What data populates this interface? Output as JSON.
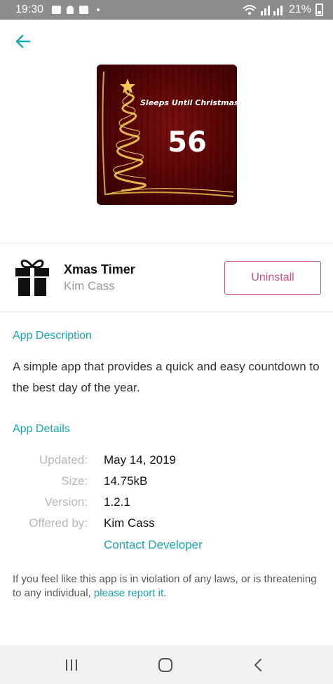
{
  "status_bar": {
    "time": "19:30",
    "battery": "21%",
    "icons": [
      "image-icon",
      "usb-icon",
      "notification-icon",
      "wifi-icon",
      "signal-icon"
    ]
  },
  "header": {
    "back_icon": "arrow-left-icon"
  },
  "hero": {
    "title": "Sleeps Until Christmas",
    "count": "56"
  },
  "app": {
    "name": "Xmas Timer",
    "author": "Kim Cass",
    "icon": "gift-icon",
    "uninstall_label": "Uninstall"
  },
  "description": {
    "title": "App Description",
    "text": "A simple app that provides a quick and easy countdown to the best day of the year."
  },
  "details": {
    "title": "App Details",
    "updated_label": "Updated:",
    "updated_value": "May 14, 2019",
    "size_label": "Size:",
    "size_value": "14.75kB",
    "version_label": "Version:",
    "version_value": "1.2.1",
    "offered_label": "Offered by:",
    "offered_value": "Kim Cass",
    "contact_label": "Contact Developer"
  },
  "report": {
    "text": "If you feel like this app is in violation of any laws, or is threatening to any individual, ",
    "link": "please report it",
    "suffix": "."
  },
  "nav": {
    "recents_icon": "recents-icon",
    "home_icon": "home-icon",
    "back_icon": "back-chevron-icon"
  },
  "colors": {
    "accent": "#1aa6ae",
    "uninstall": "#c8557a",
    "status_bar": "#8d8d8d"
  }
}
